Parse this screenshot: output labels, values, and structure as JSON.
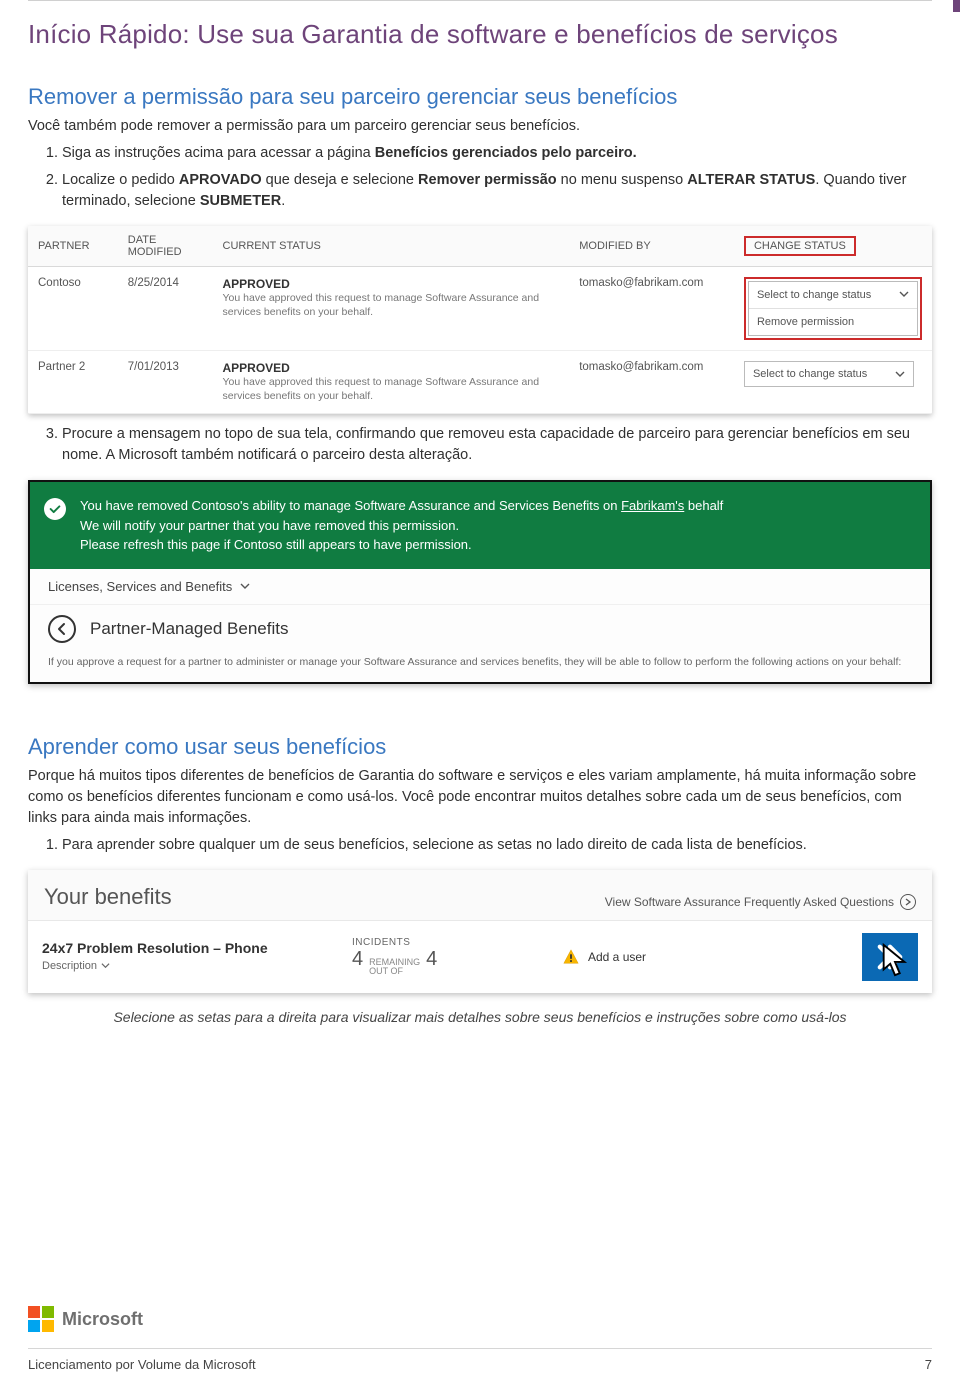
{
  "doc_title": "Início Rápido: Use sua Garantia de software e benefícios de serviços",
  "section1": {
    "heading": "Remover a permissão para seu parceiro gerenciar seus benefícios",
    "intro": "Você também pode remover a permissão para um parceiro gerenciar seus benefícios.",
    "step1_a": "Siga as instruções acima para acessar a página ",
    "step1_b": "Benefícios gerenciados pelo parceiro.",
    "step2_a": "Localize o pedido ",
    "step2_b": "APROVADO",
    "step2_c": " que deseja e selecione ",
    "step2_d": "Remover permissão",
    "step2_e": " no menu suspenso ",
    "step2_f": "ALTERAR STATUS",
    "step2_g": ". Quando tiver terminado, selecione ",
    "step2_h": "SUBMETER",
    "step2_i": "."
  },
  "partner_table": {
    "headers": {
      "partner": "PARTNER",
      "date": "DATE MODIFIED",
      "status": "CURRENT STATUS",
      "modified_by": "MODIFIED BY",
      "change": "CHANGE STATUS"
    },
    "rows": [
      {
        "partner": "Contoso",
        "date": "8/25/2014",
        "status_title": "APPROVED",
        "status_desc": "You have approved this request to manage Software Assurance and services benefits on your behalf.",
        "modified_by": "tomasko@fabrikam.com",
        "select_label": "Select to change status",
        "dropdown_option": "Remove permission"
      },
      {
        "partner": "Partner 2",
        "date": "7/01/2013",
        "status_title": "APPROVED",
        "status_desc": "You have approved this request to manage Software Assurance and services benefits on your behalf.",
        "modified_by": "tomasko@fabrikam.com",
        "select_label": "Select to change status"
      }
    ]
  },
  "step3": "Procure a mensagem no topo de sua tela, confirmando que removeu esta capacidade de parceiro para gerenciar benefícios em seu nome. A Microsoft também notificará o parceiro desta alteração.",
  "green": {
    "line1_a": "You have removed Contoso's ability to manage Software Assurance and Services Benefits on ",
    "line1_b": "Fabrikam's",
    "line1_c": " behalf",
    "line2": "We will notify your partner that you have removed this permission.",
    "line3": "Please refresh this page if Contoso still appears to have permission.",
    "breadcrumb": "Licenses, Services and Benefits",
    "pmb": "Partner-Managed Benefits",
    "note": "If you approve a request for a partner to administer or manage your Software Assurance and services benefits, they will be able to follow to perform the following actions on your behalf:"
  },
  "section2": {
    "heading": "Aprender como usar seus benefícios",
    "p": "Porque há muitos tipos diferentes de benefícios de Garantia do software e serviços e eles variam amplamente, há muita informação sobre como os benefícios diferentes funcionam e como usá-los. Você pode encontrar muitos detalhes sobre cada um de seus benefícios, com links para ainda mais informações.",
    "li": "Para aprender sobre qualquer um de seus benefícios, selecione as setas no lado direito de cada lista de benefícios."
  },
  "your_benefits": {
    "title": "Your benefits",
    "faq": "View Software Assurance Frequently Asked Questions",
    "item_name": "24x7 Problem Resolution – Phone",
    "description_label": "Description",
    "incidents_label": "INCIDENTS",
    "remaining": "4",
    "remaining_mid_a": "REMAINING",
    "remaining_mid_b": "OUT OF",
    "total": "4",
    "add_user": "Add a user"
  },
  "caption": "Selecione as setas para a direita para visualizar mais detalhes sobre seus benefícios e instruções sobre como usá-los",
  "footer": {
    "brand": "Microsoft",
    "left": "Licenciamento por Volume da Microsoft",
    "page": "7"
  }
}
